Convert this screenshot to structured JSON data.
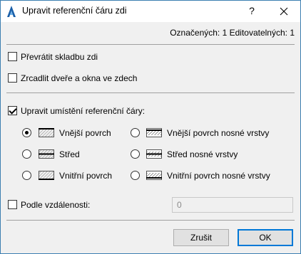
{
  "window": {
    "title": "Upravit referenční čáru zdi",
    "help_label": "?",
    "icons": {
      "app": "archicad-icon",
      "close": "close-icon"
    }
  },
  "status": "Označených: 1 Editovatelných: 1",
  "options": {
    "flip_layers": {
      "label": "Převrátit skladbu zdi",
      "checked": false
    },
    "mirror_openings": {
      "label": "Zrcadlit dveře a okna ve zdech",
      "checked": false
    },
    "edit_reference_line": {
      "label": "Upravit umístění referenční čáry:",
      "checked": true
    }
  },
  "reference_positions": [
    {
      "label": "Vnější povrch",
      "selected": true,
      "icon": "wall-exterior-icon"
    },
    {
      "label": "Střed",
      "selected": false,
      "icon": "wall-center-icon"
    },
    {
      "label": "Vnitřní povrch",
      "selected": false,
      "icon": "wall-interior-icon"
    },
    {
      "label": "Vnější povrch nosné vrstvy",
      "selected": false,
      "icon": "core-exterior-icon"
    },
    {
      "label": "Střed nosné vrstvy",
      "selected": false,
      "icon": "core-center-icon"
    },
    {
      "label": "Vnitřní povrch nosné vrstvy",
      "selected": false,
      "icon": "core-interior-icon"
    }
  ],
  "offset": {
    "label": "Podle vzdálenosti:",
    "checked": false,
    "value": "0"
  },
  "buttons": {
    "cancel": "Zrušit",
    "ok": "OK"
  },
  "colors": {
    "accent": "#0078d7",
    "window_border": "#3c7fb1",
    "background": "#f0f0f0"
  }
}
